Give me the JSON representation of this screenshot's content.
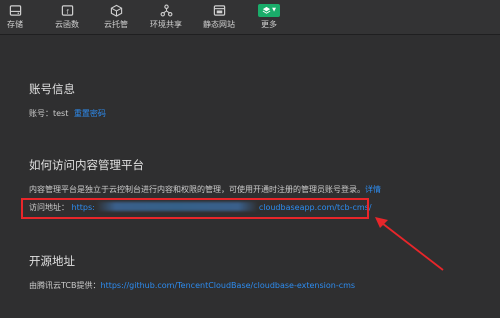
{
  "toolbar": {
    "items": [
      {
        "label": "存储",
        "icon": "hard-drive-icon"
      },
      {
        "label": "云函数",
        "icon": "function-icon"
      },
      {
        "label": "云托管",
        "icon": "cube-icon"
      },
      {
        "label": "环境共享",
        "icon": "share-icon"
      },
      {
        "label": "静态网站",
        "icon": "browser-window-icon"
      },
      {
        "label": "更多",
        "icon": "more-icon"
      }
    ],
    "more_accent": "#1aad6a"
  },
  "account": {
    "title": "账号信息",
    "account_label": "账号：",
    "account_value": "test",
    "reset_password": "重置密码"
  },
  "access": {
    "title": "如何访问内容管理平台",
    "description": "内容管理平台是独立于云控制台进行内容和权限的管理，可使用开通时注册的管理员账号登录。",
    "details_link": "详情",
    "url_label": "访问地址：",
    "url_prefix": "https:",
    "url_suffix": "cloudbaseapp.com/tcb-cms/"
  },
  "opensource": {
    "title": "开源地址",
    "provider_label": "由腾讯云TCB提供：",
    "repo_url": "https://github.com/TencentCloudBase/cloudbase-extension-cms"
  },
  "annotation_color": "#e8262a",
  "link_color": "#2d8cf0"
}
